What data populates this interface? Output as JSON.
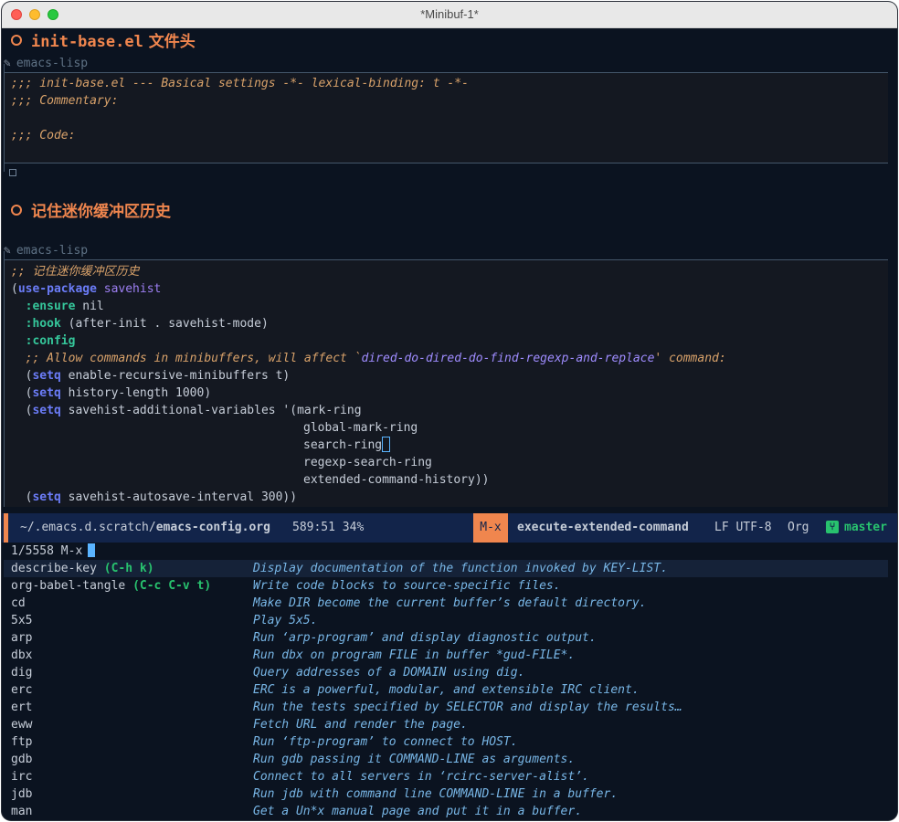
{
  "window": {
    "title": "*Minibuf-1*"
  },
  "headings": [
    {
      "title": "init-base.el",
      "suffix": " 文件头"
    },
    {
      "title": "记住迷你缓冲区历史"
    }
  ],
  "src_label": "emacs-lisp",
  "block1": [
    ";;; init-base.el --- Basical settings -*- lexical-binding: t -*-",
    ";;; Commentary:",
    "",
    ";;; Code:"
  ],
  "block2": {
    "comment_cn": ";; 记住迷你缓冲区历史",
    "l2_a": "(",
    "l2_kw": "use-package",
    "l2_b": " ",
    "l2_fn": "savehist",
    "l3_key": ":ensure",
    "l3_rest": " nil",
    "l4_key": ":hook",
    "l4_rest": " (after-init . savehist-mode)",
    "l5_key": ":config",
    "l6_a": ";; Allow commands in minibuffers, will affect `",
    "l6_b": "dired-do-dired-do-find-regexp-and-replace",
    "l6_c": "' command:",
    "setq": "setq",
    "l7_rest": " enable-recursive-minibuffers t)",
    "l8_rest": " history-length 1000)",
    "l9_rest": " savehist-additional-variables '(mark-ring",
    "l10": "global-mark-ring",
    "l11": "search-ring",
    "l12": "regexp-search-ring",
    "l13": "extended-command-history))",
    "l14_rest": " savehist-autosave-interval 300))"
  },
  "modeline": {
    "path_dir": "~/.emacs.d.scratch/",
    "path_file": "emacs-config.org",
    "position": "589:51 34%",
    "mx": "M-x",
    "command": "execute-extended-command",
    "encoding": "LF UTF-8",
    "mode": "Org",
    "git_icon": "git-branch-icon",
    "branch": "master"
  },
  "minibuffer": {
    "prompt": "1/5558 M-x",
    "candidates": [
      {
        "name": "describe-key",
        "key": "(C-h k)",
        "desc": "Display documentation of the function invoked by KEY-LIST."
      },
      {
        "name": "org-babel-tangle",
        "key": "(C-c C-v t)",
        "desc": "Write code blocks to source-specific files."
      },
      {
        "name": "cd",
        "key": "",
        "desc": "Make DIR become the current buffer’s default directory."
      },
      {
        "name": "5x5",
        "key": "",
        "desc": "Play 5x5."
      },
      {
        "name": "arp",
        "key": "",
        "desc": "Run ‘arp-program’ and display diagnostic output."
      },
      {
        "name": "dbx",
        "key": "",
        "desc": "Run dbx on program FILE in buffer *gud-FILE*."
      },
      {
        "name": "dig",
        "key": "",
        "desc": "Query addresses of a DOMAIN using dig."
      },
      {
        "name": "erc",
        "key": "",
        "desc": "ERC is a powerful, modular, and extensible IRC client."
      },
      {
        "name": "ert",
        "key": "",
        "desc": "Run the tests specified by SELECTOR and display the results…"
      },
      {
        "name": "eww",
        "key": "",
        "desc": "Fetch URL and render the page."
      },
      {
        "name": "ftp",
        "key": "",
        "desc": "Run ‘ftp-program’ to connect to HOST."
      },
      {
        "name": "gdb",
        "key": "",
        "desc": "Run gdb passing it COMMAND-LINE as arguments."
      },
      {
        "name": "irc",
        "key": "",
        "desc": "Connect to all servers in ‘rcirc-server-alist’."
      },
      {
        "name": "jdb",
        "key": "",
        "desc": "Run jdb with command line COMMAND-LINE in a buffer."
      },
      {
        "name": "man",
        "key": "",
        "desc": "Get a Un*x manual page and put it in a buffer."
      }
    ]
  },
  "colors": {
    "accent": "#f0864e",
    "modeline_bg": "#12244a",
    "bg": "#0b1320",
    "cursor": "#5ab4ff",
    "keybinding": "#28c26e"
  }
}
